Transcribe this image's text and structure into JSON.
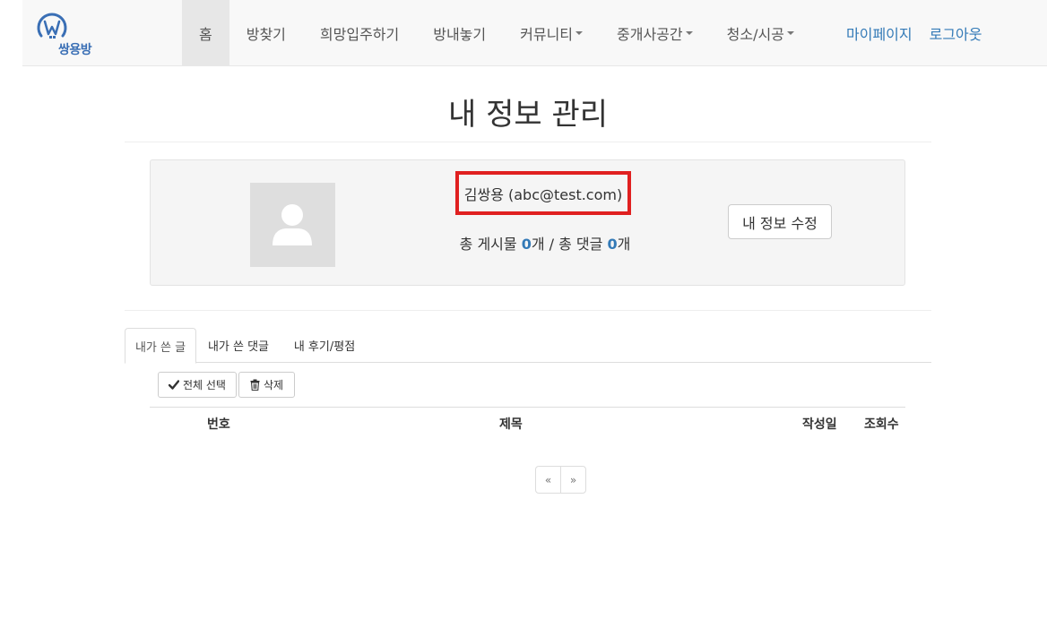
{
  "brand": {
    "logo_text": "쌍용방",
    "accent": "#3a6fb5"
  },
  "nav": {
    "items": [
      {
        "label": "홈",
        "active": true,
        "dropdown": false
      },
      {
        "label": "방찾기",
        "active": false,
        "dropdown": false
      },
      {
        "label": "희망입주하기",
        "active": false,
        "dropdown": false
      },
      {
        "label": "방내놓기",
        "active": false,
        "dropdown": false
      },
      {
        "label": "커뮤니티",
        "active": false,
        "dropdown": true
      },
      {
        "label": "중개사공간",
        "active": false,
        "dropdown": true
      },
      {
        "label": "청소/시공",
        "active": false,
        "dropdown": true
      }
    ],
    "mypage": "마이페이지",
    "logout": "로그아웃"
  },
  "page": {
    "title": "내 정보 관리"
  },
  "profile": {
    "name_email": "김쌍용 (abc@test.com)",
    "stats_prefix": "총 게시물",
    "post_count": "0",
    "stats_middle": "개 / 총 댓글",
    "comment_count": "0",
    "stats_suffix": "개",
    "edit_button": "내 정보 수정",
    "highlight_color": "#e02020"
  },
  "tabs": [
    {
      "label": "내가 쓴 글",
      "active": true
    },
    {
      "label": "내가 쓴 댓글",
      "active": false
    },
    {
      "label": "내 후기/평점",
      "active": false
    }
  ],
  "actions": {
    "select_all": "전체 선택",
    "delete": "삭제"
  },
  "table": {
    "columns": [
      "번호",
      "제목",
      "작성일",
      "조회수"
    ]
  },
  "pagination": {
    "prev": "«",
    "next": "»"
  }
}
